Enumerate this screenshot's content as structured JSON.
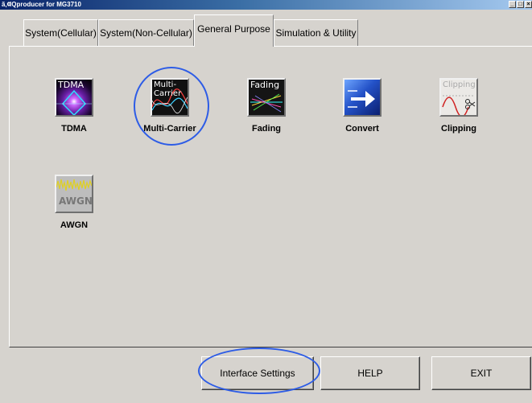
{
  "window": {
    "title": "IQproducer for MG3710",
    "app_icon": "ã‚¢",
    "min_glyph": "_",
    "max_glyph": "□",
    "close_glyph": "×"
  },
  "tabs": [
    {
      "label": "System(Cellular)",
      "active": false
    },
    {
      "label": "System(Non-Cellular)",
      "active": false
    },
    {
      "label": "General Purpose",
      "active": true
    },
    {
      "label": "Simulation & Utility",
      "active": false
    }
  ],
  "tools": [
    {
      "label": "TDMA",
      "icon_text": "TDMA",
      "icon": "tdma-icon"
    },
    {
      "label": "Multi-Carrier",
      "icon_text": "Multi-\nCarrier",
      "icon": "multi-carrier-icon"
    },
    {
      "label": "Fading",
      "icon_text": "Fading",
      "icon": "fading-icon"
    },
    {
      "label": "Convert",
      "icon_text": "",
      "icon": "convert-icon"
    },
    {
      "label": "Clipping",
      "icon_text": "Clipping",
      "icon": "clipping-icon"
    },
    {
      "label": "AWGN",
      "icon_text": "AWGN",
      "icon": "awgn-icon"
    }
  ],
  "buttons": {
    "interface_settings": "Interface Settings",
    "help": "HELP",
    "exit": "EXIT"
  },
  "colors": {
    "window_bg": "#d6d3ce",
    "highlight_circle": "#2d5ce6",
    "titlebar": "#0a246a"
  }
}
